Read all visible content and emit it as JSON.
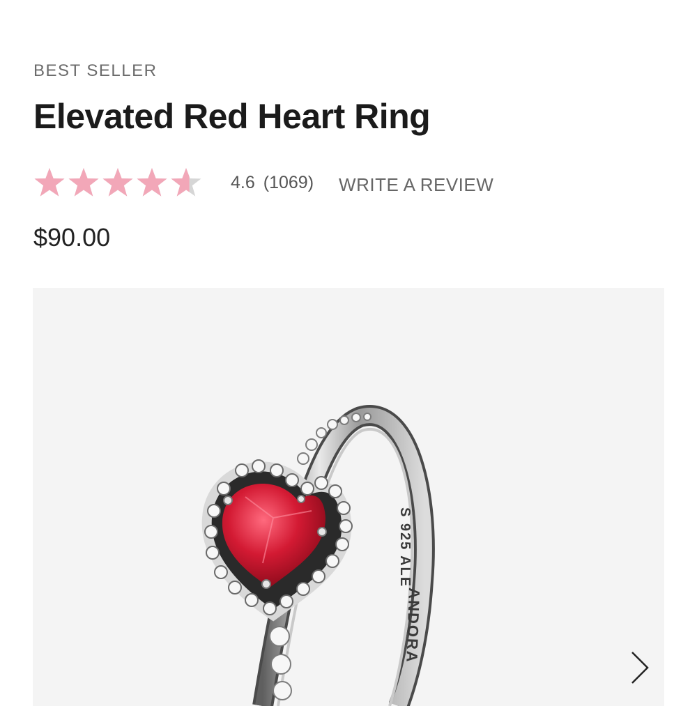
{
  "product": {
    "badge": "BEST SELLER",
    "title": "Elevated Red Heart Ring",
    "rating": {
      "value": 4.6,
      "value_text": "4.6",
      "count_text": "(1069)",
      "max": 5,
      "star_color": "#f2a7b8",
      "star_empty_color": "#d6d6d6"
    },
    "write_review_label": "WRITE A REVIEW",
    "price": "$90.00"
  },
  "gallery": {
    "background": "#f4f4f4",
    "image_icon": "ring-photo",
    "engraving_1": "S 925 ALE",
    "engraving_2": "ANDORA",
    "next_icon": "chevron-right-icon"
  }
}
